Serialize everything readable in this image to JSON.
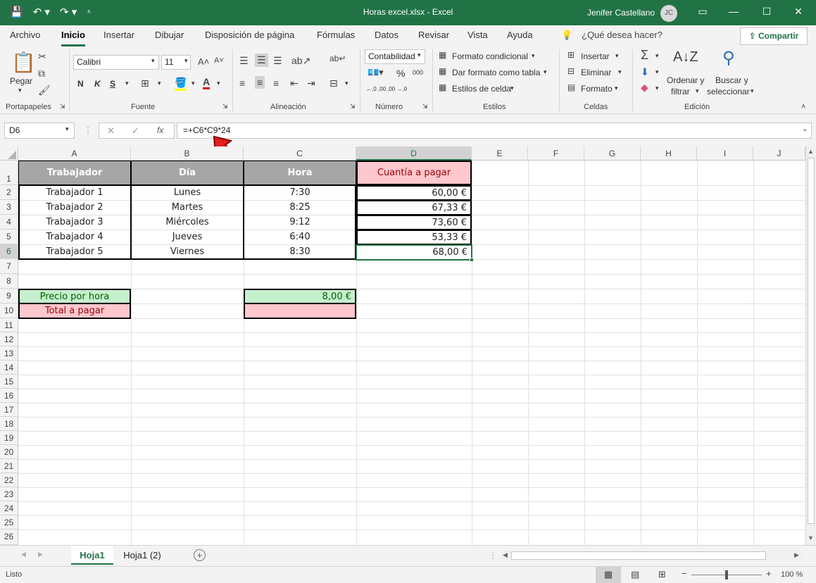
{
  "window": {
    "title": "Horas excel.xlsx  -  Excel",
    "user": "Jenifer Castellano",
    "initials": "JC"
  },
  "tabs": [
    "Archivo",
    "Inicio",
    "Insertar",
    "Dibujar",
    "Disposición de página",
    "Fórmulas",
    "Datos",
    "Revisar",
    "Vista",
    "Ayuda"
  ],
  "tell_me": "¿Qué desea hacer?",
  "share": "Compartir",
  "ribbon": {
    "paste": "Pegar",
    "font_name": "Calibri",
    "font_size": "11",
    "bold": "N",
    "italic": "K",
    "underline": "S",
    "number_format": "Contabilidad",
    "percent": "%",
    "thousands": "000",
    "dec_inc": "←,0 ,00",
    "dec_dec": ",00 →,0",
    "cond_format": "Formato condicional",
    "table_format": "Dar formato como tabla",
    "cell_styles": "Estilos de celda",
    "insert": "Insertar",
    "delete": "Eliminar",
    "format": "Formato",
    "sort": "Ordenar y",
    "filter": "filtrar",
    "find": "Buscar y",
    "select": "seleccionar",
    "groups": [
      "Portapapeles",
      "Fuente",
      "Alineación",
      "Número",
      "Estilos",
      "Celdas",
      "Edición"
    ]
  },
  "formula_bar": {
    "name_box": "D6",
    "formula": "=+C6*C9*24"
  },
  "columns": [
    "A",
    "B",
    "C",
    "D",
    "E",
    "F",
    "G",
    "H",
    "I",
    "J"
  ],
  "rows": [
    "1",
    "2",
    "3",
    "4",
    "5",
    "6",
    "7",
    "8",
    "9",
    "10",
    "11",
    "12",
    "13",
    "14",
    "15",
    "16",
    "17",
    "18",
    "19",
    "20",
    "21",
    "22",
    "23",
    "24",
    "25",
    "26"
  ],
  "table": {
    "headers": [
      "Trabajador",
      "Día",
      "Hora",
      "Cuantía a pagar"
    ],
    "rows": [
      [
        "Trabajador 1",
        "Lunes",
        "7:30",
        "60,00 €"
      ],
      [
        "Trabajador 2",
        "Martes",
        "8:25",
        "67,33 €"
      ],
      [
        "Trabajador 3",
        "Miércoles",
        "9:12",
        "73,60 €"
      ],
      [
        "Trabajador 4",
        "Jueves",
        "6:40",
        "53,33 €"
      ],
      [
        "Trabajador 5",
        "Viernes",
        "8:30",
        "68,00 €"
      ]
    ],
    "price_label": "Precio por hora",
    "price_value": "8,00 €",
    "total_label": "Total a pagar",
    "total_value": ""
  },
  "sheets": [
    "Hoja1",
    "Hoja1 (2)"
  ],
  "status": {
    "ready": "Listo",
    "zoom": "100 %"
  },
  "colors": {
    "excel_green": "#217346",
    "header_gray": "#a6a6a6",
    "pink": "#ffc7ce",
    "pink_text": "#9c0006",
    "green_fill": "#c6efce",
    "green_text": "#006100"
  }
}
